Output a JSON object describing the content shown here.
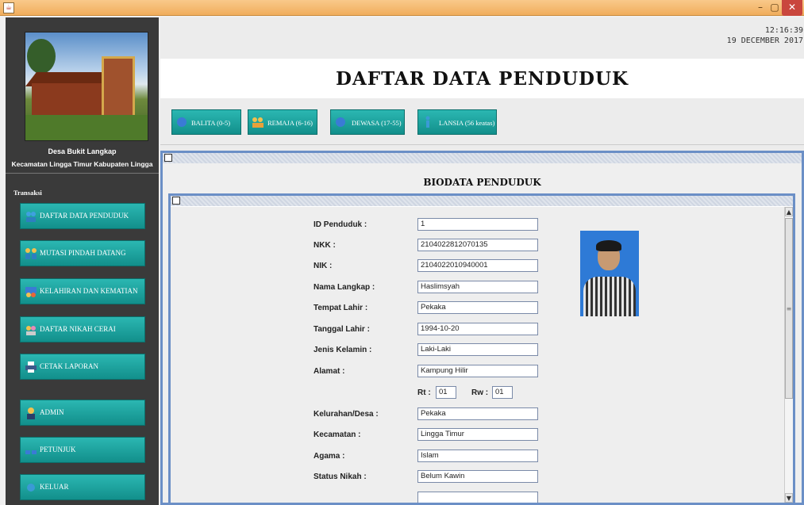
{
  "window": {
    "icon": "java-app-icon",
    "minimize": "–",
    "maximize": "▢",
    "close": "✕"
  },
  "sidebar": {
    "village_name": "Desa Bukit Langkap",
    "district_name": "Kecamatan Lingga Timur Kabupaten Lingga",
    "section_label": "Transaksi",
    "items": [
      {
        "label": "DAFTAR DATA PENDUDUK",
        "icon": "people-icon"
      },
      {
        "label": "MUTASI PINDAH DATANG",
        "icon": "users-transfer-icon"
      },
      {
        "label": "KELAHIRAN DAN KEMATIAN",
        "icon": "family-icon"
      },
      {
        "label": "DAFTAR NIKAH CERAI",
        "icon": "wedding-icon"
      },
      {
        "label": "CETAK LAPORAN",
        "icon": "printer-icon"
      },
      {
        "label": "ADMIN",
        "icon": "admin-user-icon"
      },
      {
        "label": "PETUNJUK",
        "icon": "help-icon"
      },
      {
        "label": "KELUAR",
        "icon": "exit-icon"
      }
    ]
  },
  "header": {
    "time": "12:16:39",
    "date": "19 DECEMBER 2017",
    "title": "DAFTAR DATA PENDUDUK"
  },
  "age_filters": [
    {
      "label": "BALITA (0-5)",
      "icon": "baby-icon"
    },
    {
      "label": "REMAJA (6-16)",
      "icon": "teens-icon"
    },
    {
      "label": "DEWASA (17-55)",
      "icon": "adult-icon"
    },
    {
      "label": "LANSIA (56 keatas)",
      "icon": "elderly-icon"
    }
  ],
  "biodata": {
    "title": "BIODATA PENDUDUK",
    "fields": [
      {
        "label": "ID Penduduk :",
        "value": "1"
      },
      {
        "label": "NKK :",
        "value": "2104022812070135"
      },
      {
        "label": "NIK :",
        "value": "2104022010940001"
      },
      {
        "label": "Nama Langkap :",
        "value": "Haslimsyah"
      },
      {
        "label": "Tempat Lahir :",
        "value": "Pekaka"
      },
      {
        "label": "Tanggal Lahir :",
        "value": "1994-10-20"
      },
      {
        "label": "Jenis Kelamin :",
        "value": "Laki-Laki"
      },
      {
        "label": "Alamat :",
        "value": "Kampung Hilir"
      }
    ],
    "rt_label": "Rt :",
    "rt_value": "01",
    "rw_label": "Rw :",
    "rw_value": "01",
    "fields2": [
      {
        "label": "Kelurahan/Desa :",
        "value": "Pekaka"
      },
      {
        "label": "Kecamatan :",
        "value": "Lingga Timur"
      },
      {
        "label": "Agama :",
        "value": "Islam"
      },
      {
        "label": "Status Nikah :",
        "value": "Belum Kawin"
      }
    ]
  },
  "colors": {
    "accent": "#1aa39e",
    "sidebar_bg": "#3a3a3a",
    "frame_border": "#6b8fc6"
  }
}
